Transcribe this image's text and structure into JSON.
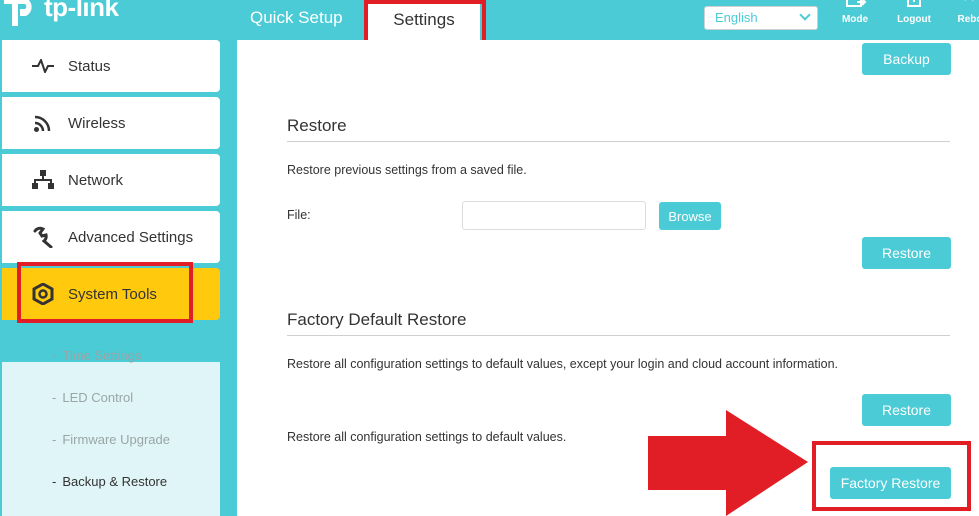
{
  "header": {
    "brand": "tp-link",
    "tabs": [
      {
        "label": "Quick Setup",
        "active": false
      },
      {
        "label": "Settings",
        "active": true
      }
    ],
    "language": {
      "selected": "English"
    },
    "icons": [
      {
        "name": "mode-icon",
        "label": "Mode"
      },
      {
        "name": "logout-icon",
        "label": "Logout"
      },
      {
        "name": "reboot-icon",
        "label": "Rebo"
      }
    ]
  },
  "sidebar": {
    "items": [
      {
        "label": "Status",
        "icon": "status-icon"
      },
      {
        "label": "Wireless",
        "icon": "wireless-icon"
      },
      {
        "label": "Network",
        "icon": "network-icon"
      },
      {
        "label": "Advanced Settings",
        "icon": "advanced-settings-icon"
      },
      {
        "label": "System Tools",
        "icon": "system-tools-icon",
        "active": true
      }
    ],
    "sub_items": [
      {
        "label": "Time Settings",
        "active": false
      },
      {
        "label": "LED Control",
        "active": false
      },
      {
        "label": "Firmware Upgrade",
        "active": false
      },
      {
        "label": "Backup & Restore",
        "active": true
      }
    ]
  },
  "main": {
    "backup_button": "Backup",
    "restore": {
      "title": "Restore",
      "description": "Restore previous settings from a saved file.",
      "file_label": "File:",
      "file_value": "",
      "browse_button": "Browse",
      "restore_button": "Restore"
    },
    "factory": {
      "title": "Factory Default Restore",
      "description1": "Restore all configuration settings to default values, except your login and cloud account information.",
      "restore_button": "Restore",
      "description2": "Restore all configuration settings to default values.",
      "factory_restore_button": "Factory Restore"
    }
  },
  "colors": {
    "accent": "#4acbd6",
    "active_nav": "#ffc90e",
    "highlight": "#e11e26"
  }
}
